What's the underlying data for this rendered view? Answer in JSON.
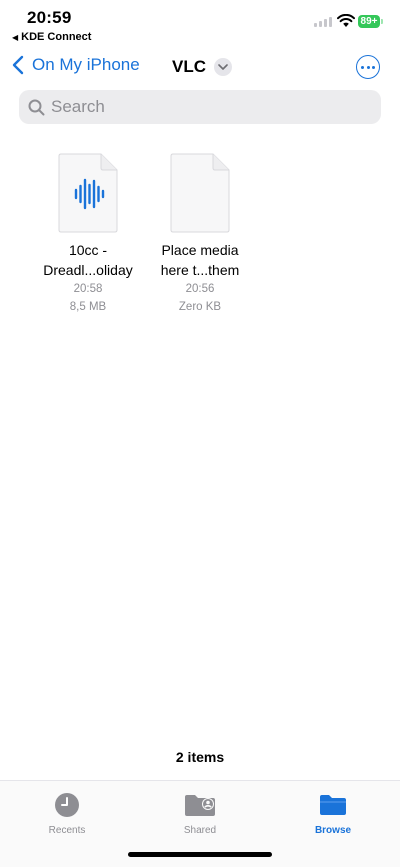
{
  "status_bar": {
    "time": "20:59",
    "back_app": "KDE Connect",
    "battery": "89+"
  },
  "nav": {
    "back_label": "On My iPhone",
    "title": "VLC"
  },
  "search": {
    "placeholder": "Search"
  },
  "files": [
    {
      "name_line1": "10cc -",
      "name_line2": "Dreadl...oliday",
      "time": "20:58",
      "size": "8,5 MB",
      "icon": "audio-waveform-icon"
    },
    {
      "name_line1": "Place media",
      "name_line2": "here t...them",
      "time": "20:56",
      "size": "Zero KB",
      "icon": "blank-document-icon"
    }
  ],
  "footer": {
    "item_count": "2 items"
  },
  "tabs": [
    {
      "label": "Recents",
      "icon": "clock-icon"
    },
    {
      "label": "Shared",
      "icon": "shared-folder-icon"
    },
    {
      "label": "Browse",
      "icon": "folder-icon"
    }
  ],
  "colors": {
    "accent": "#1a73d9",
    "battery": "#34c759",
    "secondary_text": "#8e8e93"
  }
}
